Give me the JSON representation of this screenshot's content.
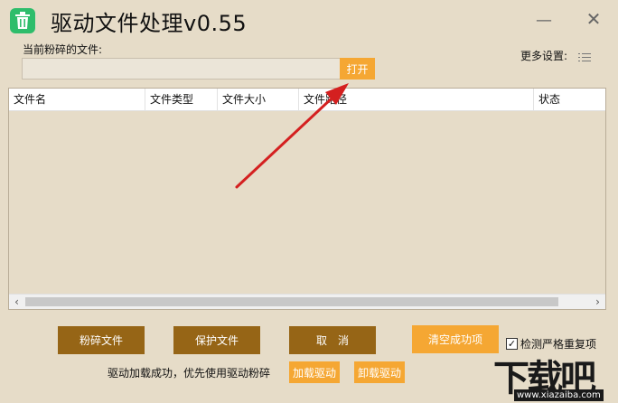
{
  "app": {
    "title": "驱动文件处理v0.55",
    "minimize_glyph": "—",
    "close_glyph": "✕"
  },
  "file_field": {
    "label": "当前粉碎的文件:",
    "value": "",
    "open_button": "打开"
  },
  "settings": {
    "more_label": "更多设置:"
  },
  "table": {
    "columns": [
      "文件名",
      "文件类型",
      "文件大小",
      "文件路径",
      "状态"
    ],
    "rows": []
  },
  "actions": {
    "shred": "粉碎文件",
    "protect": "保护文件",
    "cancel": "取　消",
    "clear_success": "清空成功项",
    "check_duplicates": "检测严格重复项",
    "check_duplicates_checked": true,
    "load_driver": "加载驱动",
    "unload_driver": "卸载驱动"
  },
  "status": {
    "message": "驱动加载成功，优先使用驱动粉碎"
  },
  "watermark": {
    "logo": "下载吧",
    "url": "www.xiazaiba.com"
  },
  "colors": {
    "background": "#e6dcc8",
    "accent_orange": "#f5a733",
    "button_brown": "#966516",
    "icon_green": "#2ebd6b",
    "annotation_red": "#d42020"
  }
}
